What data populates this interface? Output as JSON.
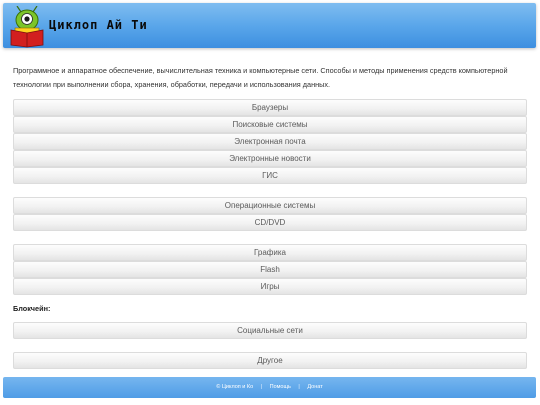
{
  "header": {
    "title": "Циклоп Ай Ти"
  },
  "intro": "Программное и аппаратное обеспечение, вычислительная техника и компьютерные сети. Способы и методы применения средств компьютерной технологии при выполнении сбора, хранения, обработки, передачи и использования данных.",
  "menu": {
    "group1": [
      "Браузеры",
      "Поисковые системы",
      "Электронная почта",
      "Электронные новости",
      "ГИС"
    ],
    "group2": [
      "Операционные системы",
      "CD/DVD"
    ],
    "group3": [
      "Графика",
      "Flash",
      "Игры"
    ],
    "blockchain_label": "Блокчейн:",
    "group4": [
      "Социальные сети"
    ],
    "group5": [
      "Другое"
    ]
  },
  "footer": {
    "copyright": "© Циклоп и Ко",
    "help": "Помощь",
    "donate": "Донат",
    "separator": "|"
  },
  "colors": {
    "header_blue": "#5aa6ea",
    "footer_blue": "#4f9ce6",
    "mascot_green": "#7cc52a",
    "book_red": "#d21f1f"
  }
}
